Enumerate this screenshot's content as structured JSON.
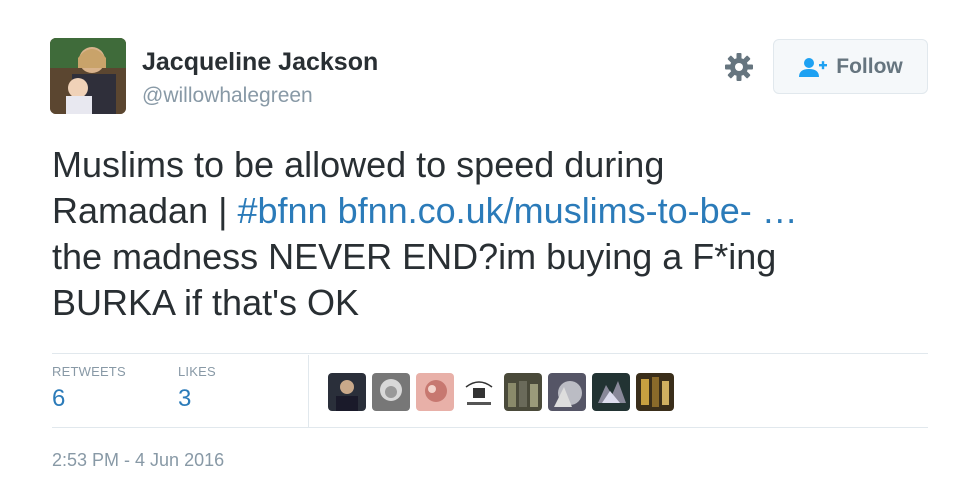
{
  "user": {
    "display_name": "Jacqueline Jackson",
    "handle": "@willowhalegreen"
  },
  "follow_button": {
    "label": "Follow"
  },
  "icons": {
    "settings": "gear-icon",
    "follow": "add-user-icon"
  },
  "tweet": {
    "line1": "Muslims to be allowed to speed during",
    "line2_prefix": "Ramadan | ",
    "hashtag": "#bfnn",
    "link": "bfnn.co.uk/muslims-to-be- …",
    "line3": "the madness NEVER END?im buying a F*ing",
    "line4": "BURKA if that's OK"
  },
  "stats": {
    "retweets_label": "RETWEETS",
    "retweets_count": "6",
    "likes_label": "LIKES",
    "likes_count": "3"
  },
  "likers_count_shown": 8,
  "timestamp": "2:53 PM - 4 Jun 2016",
  "colors": {
    "link": "#2b7bb9",
    "text": "#292f33",
    "muted": "#8899a6",
    "divider": "#e1e8ed"
  }
}
